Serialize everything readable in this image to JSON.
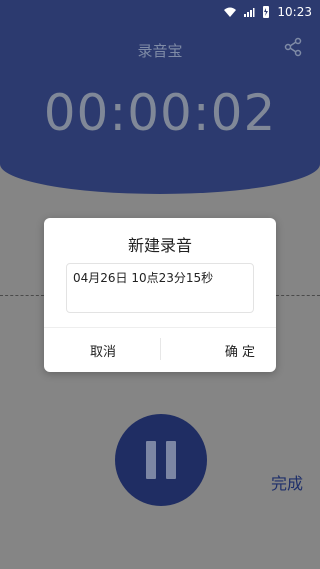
{
  "statusbar": {
    "time": "10:23",
    "icons": [
      "wifi-icon",
      "signal-icon",
      "battery-icon"
    ]
  },
  "header": {
    "title": "录音宝",
    "share_icon": "share-icon",
    "timer": "00:00:02"
  },
  "modal": {
    "title": "新建录音",
    "input_value": "04月26日 10点23分15秒",
    "cancel_label": "取消",
    "ok_label": "确 定"
  },
  "controls": {
    "pause_icon": "pause-icon",
    "done_label": "完成"
  },
  "colors": {
    "header_bg": "#2c3a6f",
    "page_overlay": "#858585",
    "accent": "#1e2f6a"
  }
}
